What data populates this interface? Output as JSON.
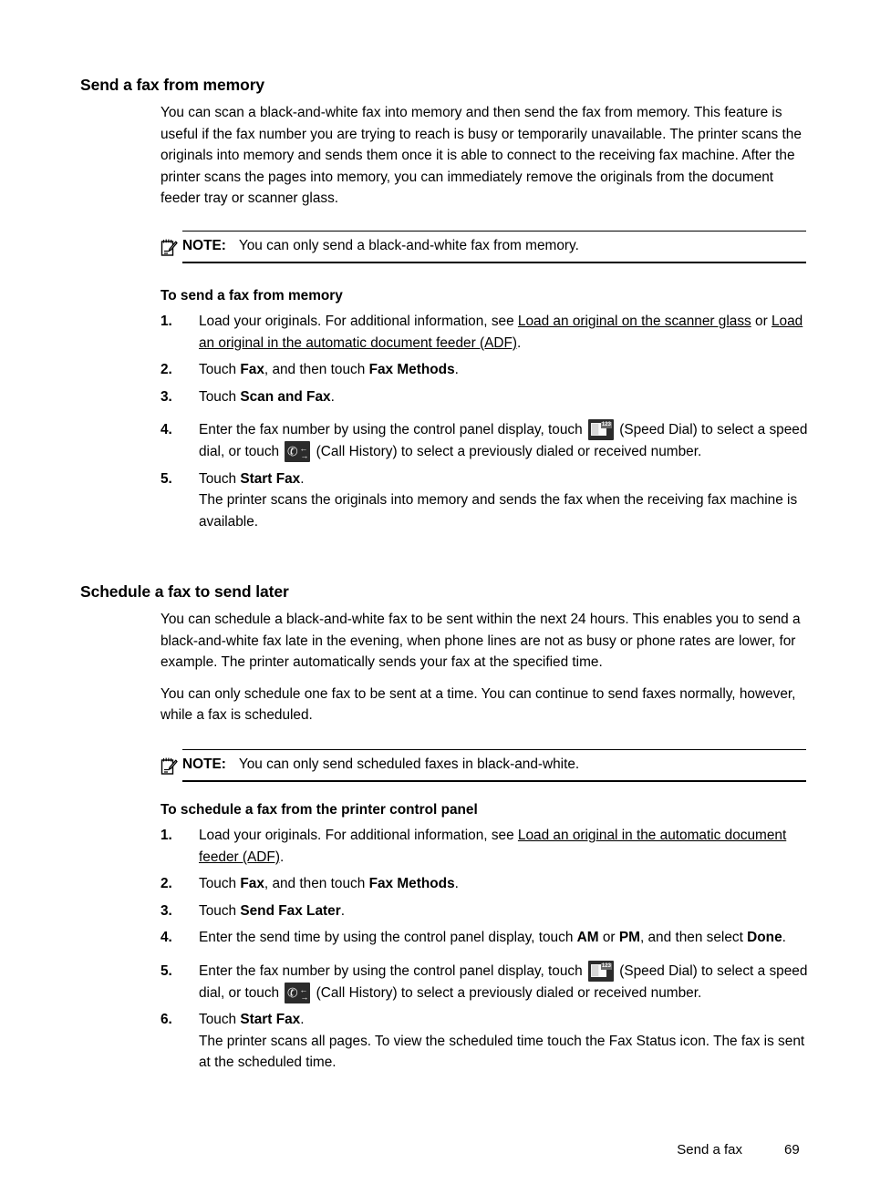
{
  "document": {
    "footer": {
      "chapter": "Send a fax",
      "page_number": "69"
    }
  },
  "sections": [
    {
      "heading": "Send a fax from memory",
      "intro": "You can scan a black-and-white fax into memory and then send the fax from memory. This feature is useful if the fax number you are trying to reach is busy or temporarily unavailable. The printer scans the originals into memory and sends them once it is able to connect to the receiving fax machine. After the printer scans the pages into memory, you can immediately remove the originals from the document feeder tray or scanner glass.",
      "note": {
        "label": "NOTE:",
        "text": "You can only send a black-and-white fax from memory.",
        "icon": "note-pad-pencil-icon"
      },
      "procedure_heading": "To send a fax from memory",
      "steps": {
        "s1_a": "Load your originals. For additional information, see ",
        "s1_link1": "Load an original on the scanner glass",
        "s1_b": " or ",
        "s1_link2": "Load an original in the automatic document feeder (ADF)",
        "s1_c": ".",
        "s2_a": "Touch ",
        "s2_b1": "Fax",
        "s2_b": ", and then touch ",
        "s2_b2": "Fax Methods",
        "s2_c": ".",
        "s3_a": "Touch ",
        "s3_b1": "Scan and Fax",
        "s3_c": ".",
        "s4_a": "Enter the fax number by using the control panel display, touch ",
        "s4_b": " (Speed Dial) to select a speed dial, or touch ",
        "s4_c": " (Call History) to select a previously dialed or received number.",
        "s5_a": "Touch ",
        "s5_b1": "Start Fax",
        "s5_c": ".",
        "s5_detail": "The printer scans the originals into memory and sends the fax when the receiving fax machine is available."
      },
      "numbers": [
        "1.",
        "2.",
        "3.",
        "4.",
        "5."
      ]
    },
    {
      "heading": "Schedule a fax to send later",
      "intro1": "You can schedule a black-and-white fax to be sent within the next 24 hours. This enables you to send a black-and-white fax late in the evening, when phone lines are not as busy or phone rates are lower, for example. The printer automatically sends your fax at the specified time.",
      "intro2": "You can only schedule one fax to be sent at a time. You can continue to send faxes normally, however, while a fax is scheduled.",
      "note": {
        "label": "NOTE:",
        "text": "You can only send scheduled faxes in black-and-white.",
        "icon": "note-pad-pencil-icon"
      },
      "procedure_heading": "To schedule a fax from the printer control panel",
      "steps": {
        "s1_a": "Load your originals. For additional information, see ",
        "s1_link1": "Load an original in the automatic document feeder (ADF)",
        "s1_c": ".",
        "s2_a": "Touch ",
        "s2_b1": "Fax",
        "s2_b": ", and then touch ",
        "s2_b2": "Fax Methods",
        "s2_c": ".",
        "s3_a": "Touch ",
        "s3_b1": "Send Fax Later",
        "s3_c": ".",
        "s4_a": "Enter the send time by using the control panel display, touch ",
        "s4_b1": "AM",
        "s4_b": " or ",
        "s4_b2": "PM",
        "s4_c": ", and then select ",
        "s4_b3": "Done",
        "s4_d": ".",
        "s5_a": "Enter the fax number by using the control panel display, touch ",
        "s5_b": " (Speed Dial) to select a speed dial, or touch ",
        "s5_c": " (Call History) to select a previously dialed or received number.",
        "s6_a": "Touch ",
        "s6_b1": "Start Fax",
        "s6_c": ".",
        "s6_detail": "The printer scans all pages. To view the scheduled time touch the Fax Status icon. The fax is sent at the scheduled time."
      },
      "numbers": [
        "1.",
        "2.",
        "3.",
        "4.",
        "5.",
        "6."
      ]
    }
  ],
  "icons": {
    "speed_dial": {
      "name": "speed-dial-icon",
      "digits": "123"
    },
    "call_history": {
      "name": "call-history-icon",
      "handset": "✆",
      "arrow_left": "←",
      "arrow_right": "→"
    }
  }
}
